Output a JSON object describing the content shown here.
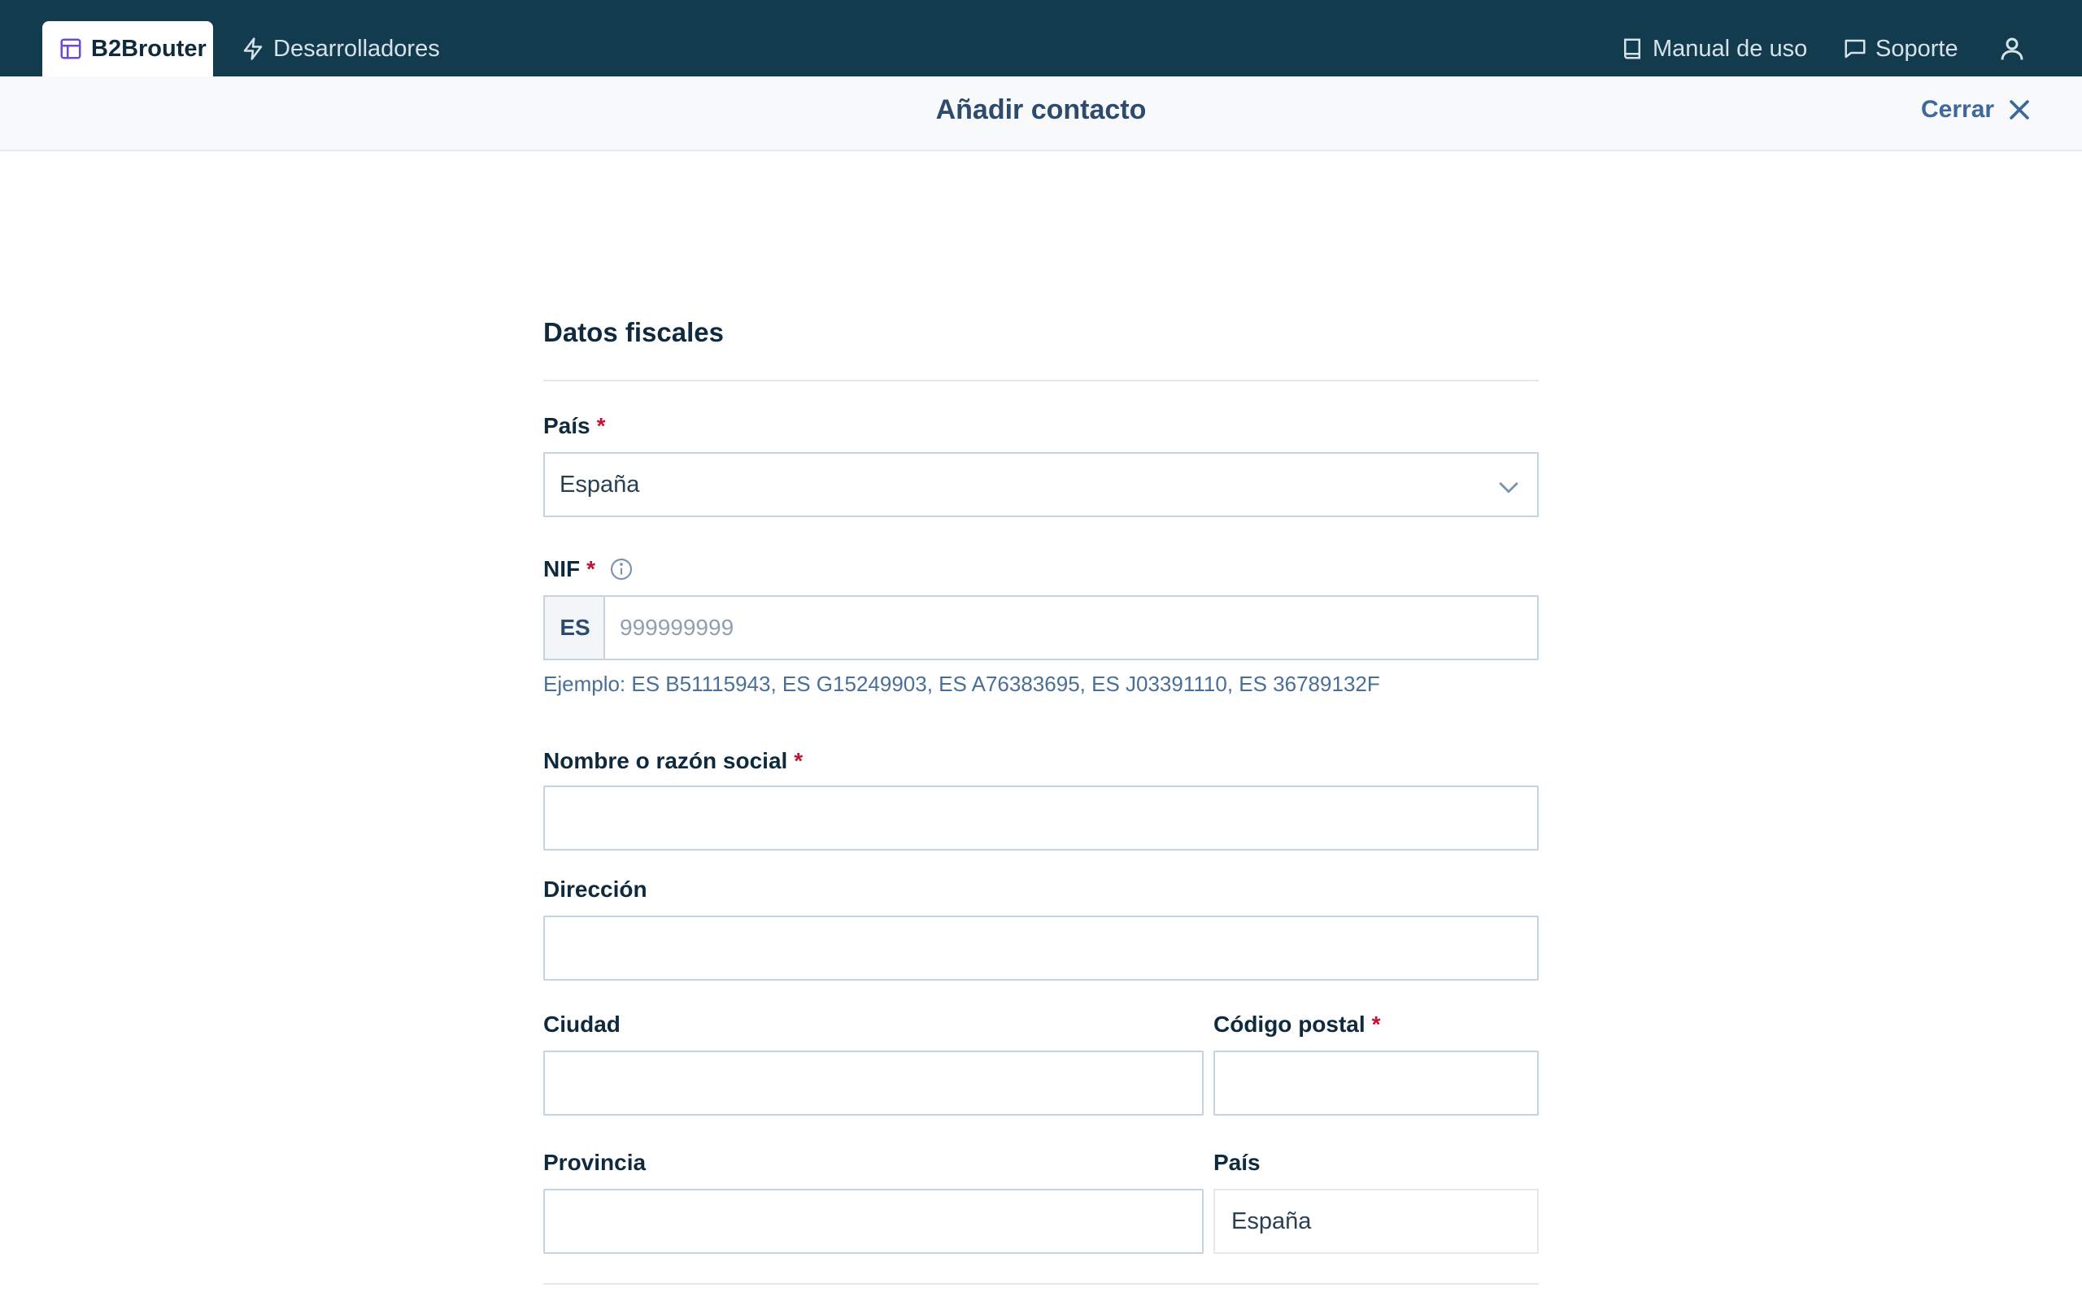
{
  "nav": {
    "app_tab": "B2Brouter",
    "dev_tab": "Desarrolladores",
    "manual": "Manual de uso",
    "support": "Soporte"
  },
  "subheader": {
    "title": "Añadir contacto",
    "close_label": "Cerrar"
  },
  "form": {
    "section_title": "Datos fiscales",
    "country": {
      "label": "País",
      "required": "*",
      "value": "España"
    },
    "nif": {
      "label": "NIF",
      "required": "*",
      "prefix": "ES",
      "placeholder": "999999999",
      "help": "Ejemplo: ES B51115943, ES G15249903, ES A76383695, ES J03391110, ES 36789132F"
    },
    "name": {
      "label": "Nombre o razón social",
      "required": "*",
      "value": ""
    },
    "address": {
      "label": "Dirección",
      "value": ""
    },
    "city": {
      "label": "Ciudad",
      "value": ""
    },
    "postal_code": {
      "label": "Código postal",
      "required": "*",
      "value": ""
    },
    "province": {
      "label": "Provincia",
      "value": ""
    },
    "country_readonly": {
      "label": "País",
      "value": "España"
    }
  },
  "colors": {
    "nav_bg": "#133b4e",
    "accent": "#3d6899",
    "required": "#c8102e",
    "brand_icon": "#6b4bd8"
  }
}
